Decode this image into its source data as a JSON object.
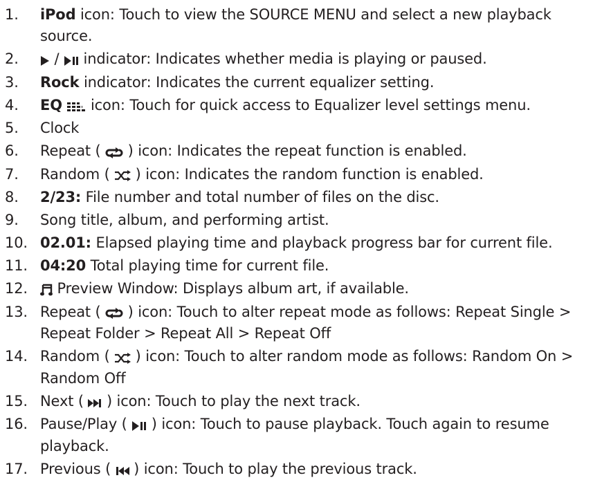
{
  "colors": {
    "text": "#231f20",
    "background": "#ffffff"
  },
  "items": [
    {
      "num": "1.",
      "bold": "iPod",
      "text": " icon: Touch to view the SOURCE MENU and select a new playback source."
    },
    {
      "num": "2.",
      "icon_a": "play-icon",
      "sep": " / ",
      "icon_b": "play-pause-icon",
      "text": " indicator: Indicates whether media is playing or paused."
    },
    {
      "num": "3.",
      "bold": "Rock",
      "text": " indicator: Indicates the current equalizer setting."
    },
    {
      "num": "4.",
      "bold": "EQ",
      "icon": "equalizer-icon",
      "text": " icon: Touch for quick access to Equalizer level settings menu."
    },
    {
      "num": "5.",
      "text": "Clock"
    },
    {
      "num": "6.",
      "pre": "Repeat ( ",
      "icon": "repeat-icon",
      "text": " ) icon: Indicates the repeat function is enabled."
    },
    {
      "num": "7.",
      "pre": "Random ( ",
      "icon": "shuffle-icon",
      "text": " ) icon: Indicates the random function is enabled."
    },
    {
      "num": "8.",
      "bold": "2/23:",
      "text": " File number and total number of files on the disc."
    },
    {
      "num": "9.",
      "text": "Song title, album, and performing artist."
    },
    {
      "num": "10.",
      "bold": "02.01:",
      "text": " Elapsed playing time and playback progress bar for current file."
    },
    {
      "num": "11.",
      "bold": "04:20",
      "text": " Total playing time for current file."
    },
    {
      "num": "12.",
      "icon": "music-note-icon",
      "text": " Preview Window: Displays album art, if available."
    },
    {
      "num": "13.",
      "pre": "Repeat ( ",
      "icon": "repeat-icon",
      "text": " ) icon: Touch to alter repeat mode as follows: Repeat Single > Repeat Folder > Repeat All > Repeat Off"
    },
    {
      "num": "14.",
      "pre": "Random ( ",
      "icon": "shuffle-icon",
      "text": " ) icon: Touch to alter random mode as follows: Random On > Random Off"
    },
    {
      "num": "15.",
      "pre": "Next ( ",
      "icon": "next-track-icon",
      "text": " ) icon: Touch to play the next track."
    },
    {
      "num": "16.",
      "pre": "Pause/Play ( ",
      "icon": "play-pause-icon",
      "text": " ) icon: Touch to pause playback. Touch again to resume playback."
    },
    {
      "num": "17.",
      "pre": "Previous ( ",
      "icon": "previous-track-icon",
      "text": " ) icon: Touch to play the previous track."
    }
  ]
}
